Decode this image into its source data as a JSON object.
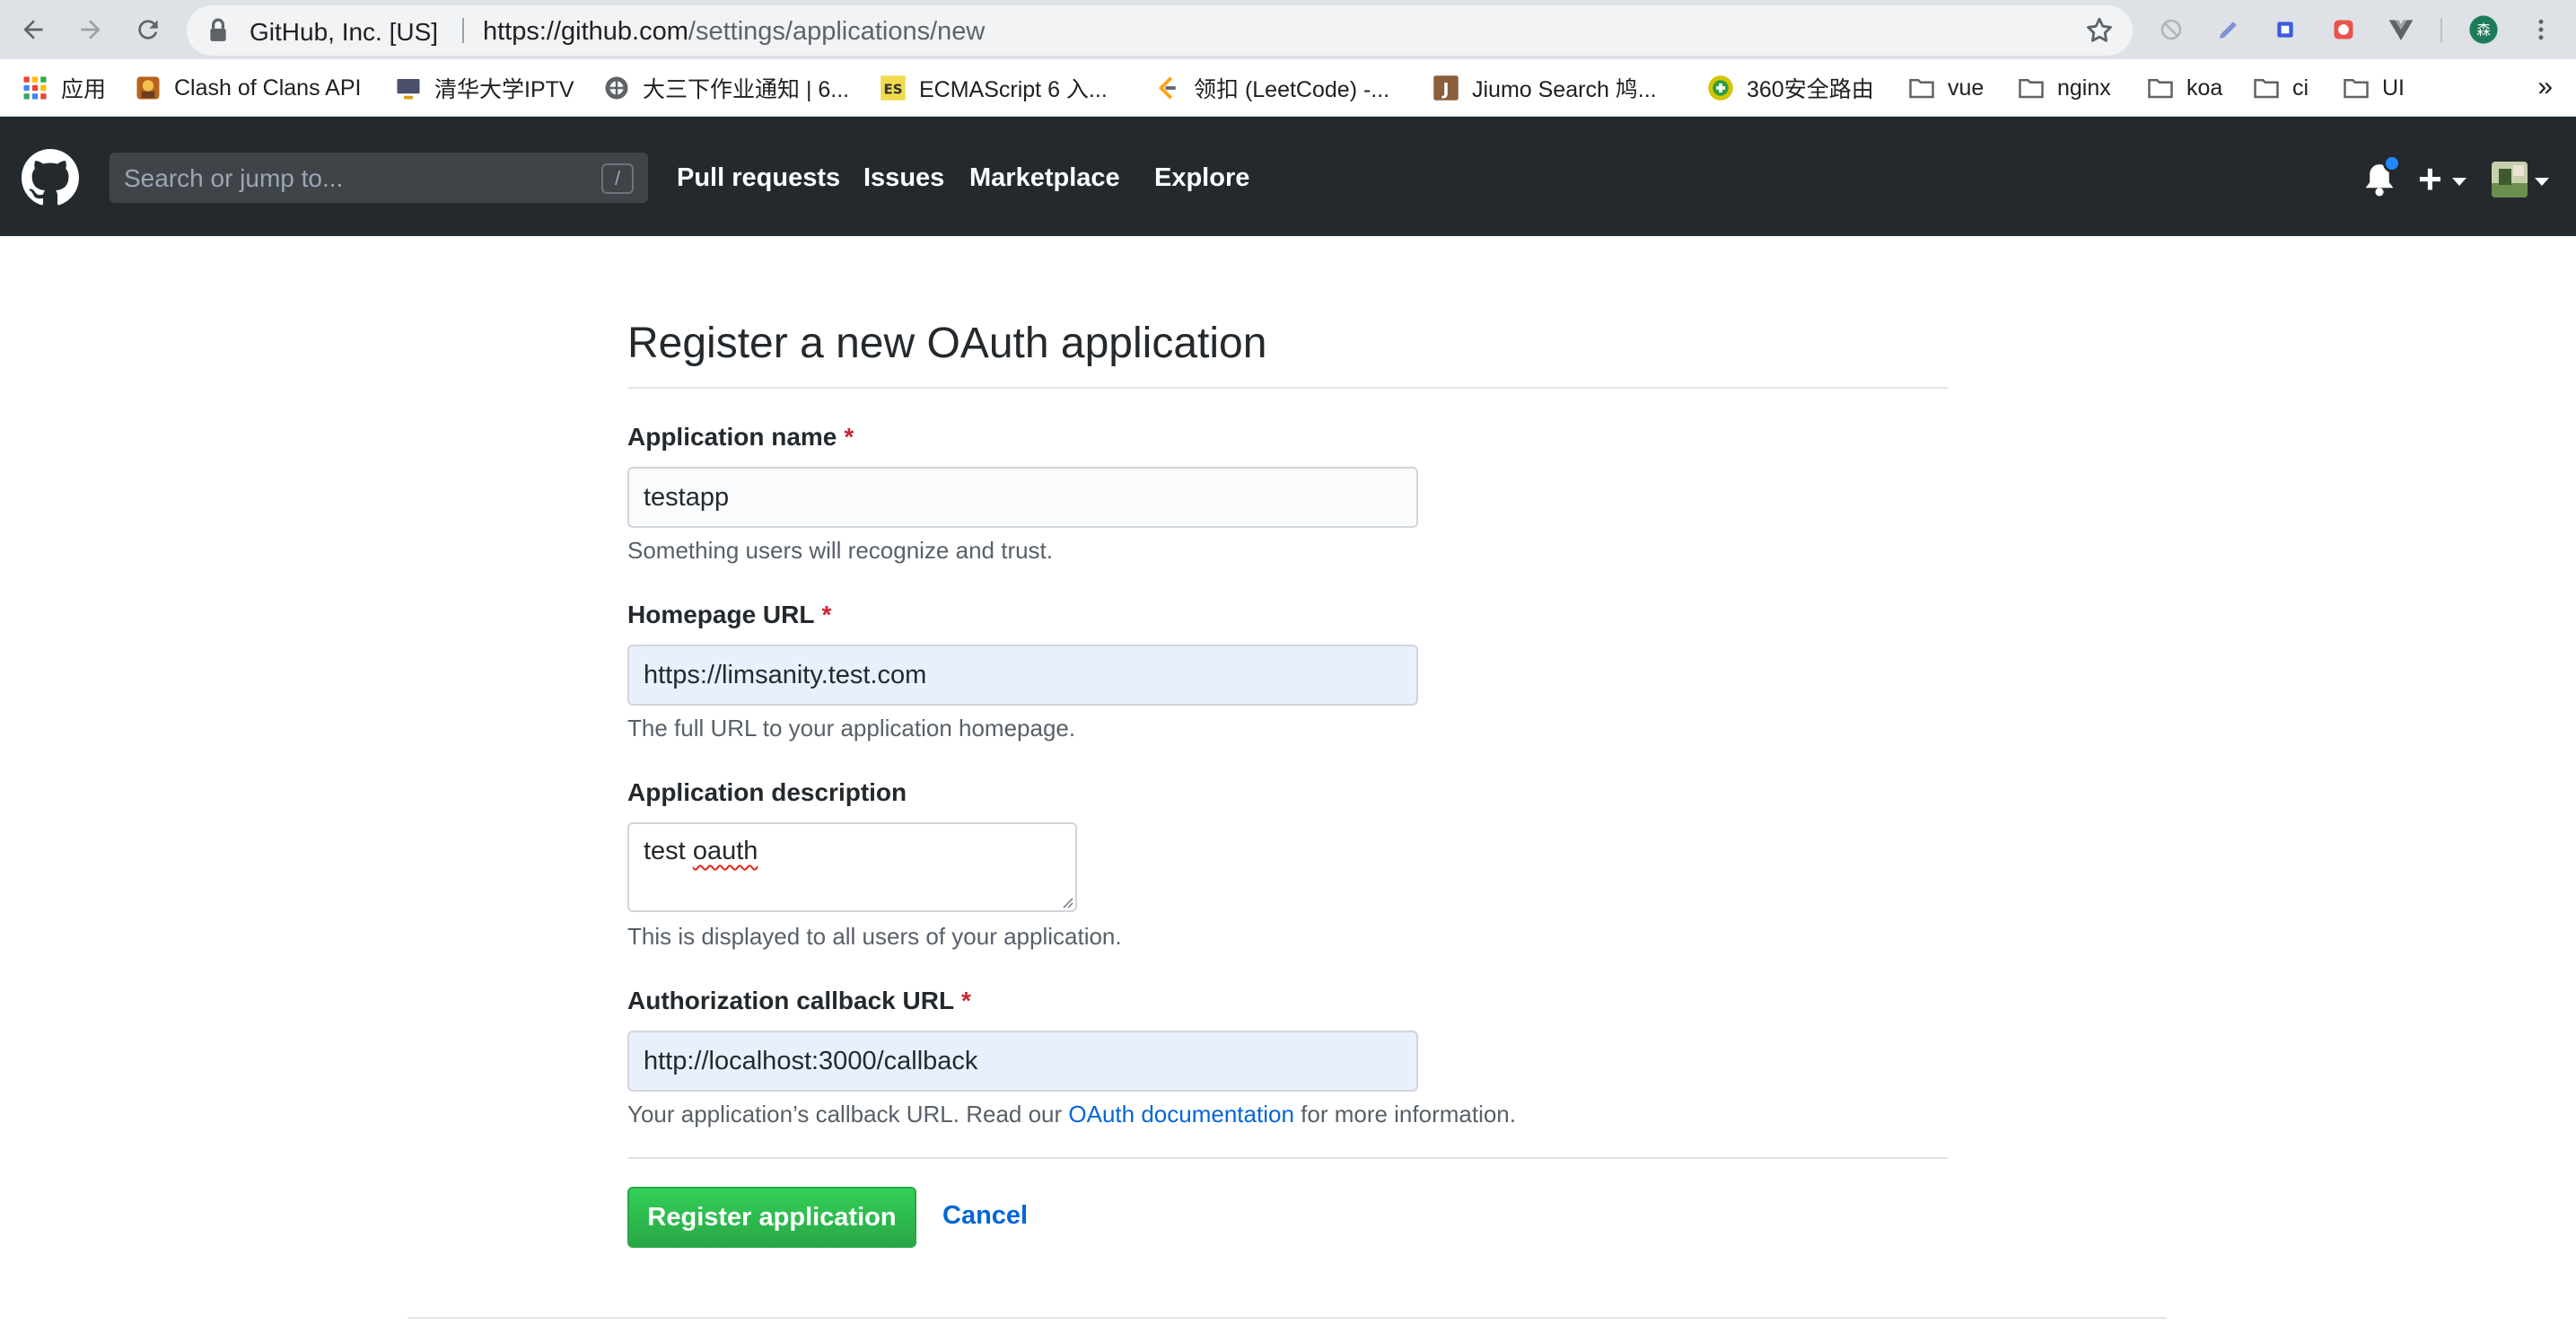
{
  "browser": {
    "site_name": "GitHub, Inc. [US]",
    "url_host": "https://github.com",
    "url_path": "/settings/applications/new",
    "bookmarks": [
      {
        "label": "应用",
        "icon": "apps-grid-icon"
      },
      {
        "label": "Clash of Clans API",
        "icon": "clash-icon"
      },
      {
        "label": "清华大学IPTV",
        "icon": "tv-icon"
      },
      {
        "label": "大三下作业通知 | 6...",
        "icon": "globe-icon"
      },
      {
        "label": "ECMAScript 6 入...",
        "icon": "es-icon"
      },
      {
        "label": "领扣 (LeetCode) -...",
        "icon": "leetcode-icon"
      },
      {
        "label": "Jiumo Search 鸠...",
        "icon": "jiumo-icon"
      },
      {
        "label": "360安全路由",
        "icon": "360-icon"
      },
      {
        "label": "vue",
        "icon": "folder-icon"
      },
      {
        "label": "nginx",
        "icon": "folder-icon"
      },
      {
        "label": "koa",
        "icon": "folder-icon"
      },
      {
        "label": "ci",
        "icon": "folder-icon"
      },
      {
        "label": "UI",
        "icon": "folder-icon"
      }
    ],
    "bookmarks_overflow": "»"
  },
  "github_header": {
    "search_placeholder": "Search or jump to...",
    "search_shortcut": "/",
    "nav": [
      "Pull requests",
      "Issues",
      "Marketplace",
      "Explore"
    ],
    "plus": "+"
  },
  "form": {
    "title": "Register a new OAuth application",
    "required_marker": "*",
    "app_name": {
      "label": "Application name",
      "value": "testapp",
      "note": "Something users will recognize and trust."
    },
    "homepage": {
      "label": "Homepage URL",
      "value": "https://limsanity.test.com",
      "note": "The full URL to your application homepage."
    },
    "description": {
      "label": "Application description",
      "value_word1": "test",
      "value_word2": "oauth",
      "note": "This is displayed to all users of your application."
    },
    "callback": {
      "label": "Authorization callback URL",
      "value": "http://localhost:3000/callback",
      "note_before": "Your application’s callback URL. Read our ",
      "note_link": "OAuth documentation",
      "note_after": " for more information."
    },
    "register_button": "Register application",
    "cancel_link": "Cancel"
  },
  "colors": {
    "header_bg": "#24292e",
    "primary_button": "#28a745",
    "link": "#0366d6",
    "required": "#cb2431",
    "autofill_bg": "#e8f0fe",
    "notification_dot": "#2188ff"
  }
}
